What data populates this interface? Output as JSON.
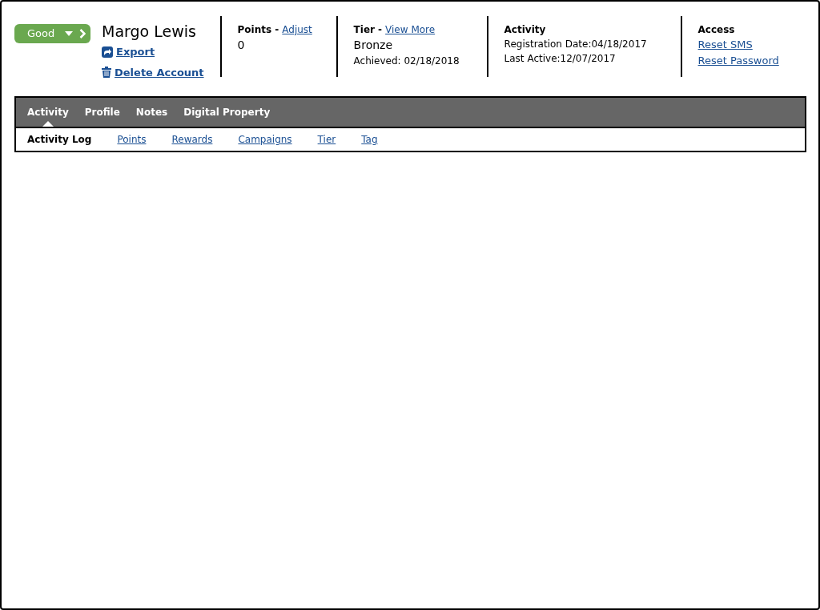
{
  "status": {
    "label": "Good"
  },
  "customer": {
    "name": "Margo Lewis",
    "actions": [
      {
        "kind": "export",
        "label": "Export"
      },
      {
        "kind": "delete",
        "label": "Delete Account"
      }
    ]
  },
  "points": {
    "title": "Points -",
    "link": "Adjust",
    "value": "0"
  },
  "tier": {
    "title": "Tier -",
    "link": "View More",
    "value": "Bronze",
    "detail": "Achieved: 02/18/2018"
  },
  "activity": {
    "title": "Activity",
    "lines": [
      "Registration Date:04/18/2017",
      "Last Active:12/07/2017"
    ]
  },
  "access": {
    "title": "Access",
    "links": [
      "Reset SMS",
      "Reset Password"
    ]
  },
  "tabs": [
    {
      "label": "Activity",
      "selected": true
    },
    {
      "label": "Profile",
      "selected": false
    },
    {
      "label": "Notes",
      "selected": false
    },
    {
      "label": "Digital Property",
      "selected": false
    }
  ],
  "subtabs": [
    {
      "label": "Activity Log",
      "selected": true
    },
    {
      "label": "Points",
      "selected": false
    },
    {
      "label": "Rewards",
      "selected": false
    },
    {
      "label": "Campaigns",
      "selected": false
    },
    {
      "label": "Tier",
      "selected": false
    },
    {
      "label": "Tag",
      "selected": false
    }
  ]
}
